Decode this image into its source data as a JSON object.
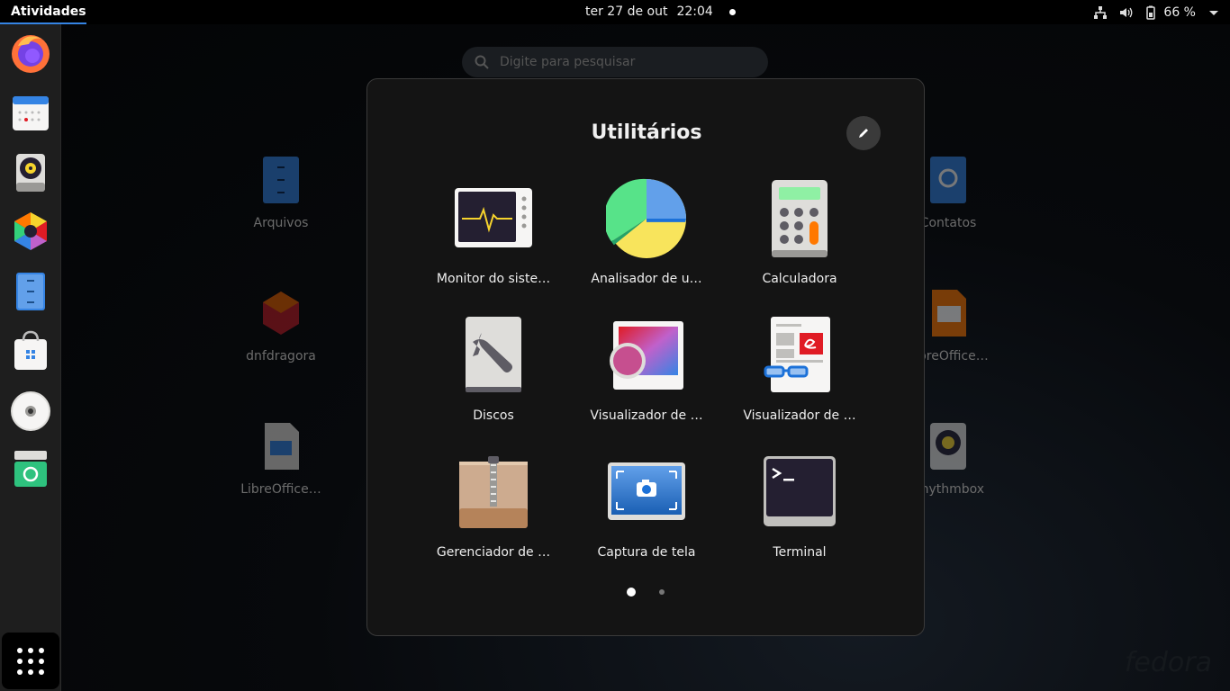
{
  "topbar": {
    "activities": "Atividades",
    "date": "ter 27 de out",
    "time": "22:04",
    "battery": "66 %"
  },
  "search": {
    "placeholder": "Digite para pesquisar"
  },
  "background_apps": [
    {
      "label": "Arquivos"
    },
    {
      "label": "dnfdragora"
    },
    {
      "label": "LibreOffice…"
    },
    {
      "label": "Contatos"
    },
    {
      "label": "LibreOffice…"
    },
    {
      "label": "Rhythmbox"
    }
  ],
  "folder": {
    "title": "Utilitários",
    "apps": [
      {
        "label": "Monitor do siste…"
      },
      {
        "label": "Analisador de u…"
      },
      {
        "label": "Calculadora"
      },
      {
        "label": "Discos"
      },
      {
        "label": "Visualizador de …"
      },
      {
        "label": "Visualizador de …"
      },
      {
        "label": "Gerenciador de …"
      },
      {
        "label": "Captura de tela"
      },
      {
        "label": "Terminal"
      }
    ],
    "page_current": 1,
    "page_count": 2
  },
  "watermark": "fedora",
  "colors": {
    "accent": "#3584e4",
    "panel": "#141414",
    "topbar": "#000000"
  }
}
